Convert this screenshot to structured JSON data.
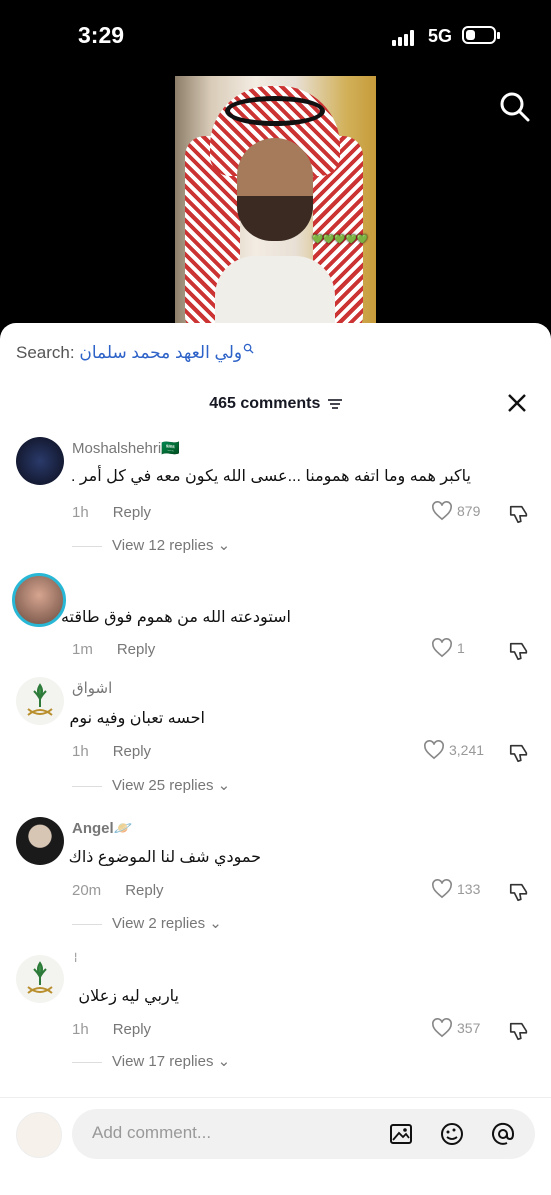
{
  "status": {
    "time": "3:29",
    "network": "5G"
  },
  "video": {
    "caption_ar": "💚💚💚💚💚"
  },
  "sheet": {
    "search_label": "Search:",
    "search_query": "ولي العهد محمد سلمان",
    "comments_count": "465 comments",
    "comments": [
      {
        "username": "Moshalshehri🇸🇦",
        "text": "ياكبر همه وما اتفه همومنا ...عسى الله يكون معه في كل أمر .",
        "time": "1h",
        "reply": "Reply",
        "likes": "879",
        "view_replies": "View 12 replies"
      },
      {
        "username": "",
        "text": "استودعته الله من هموم فوق طاقته",
        "time": "1m",
        "reply": "Reply",
        "likes": "1",
        "view_replies": ""
      },
      {
        "username": "اشواق",
        "text": "احسه تعبان وفيه نوم",
        "time": "1h",
        "reply": "Reply",
        "likes": "3,241",
        "view_replies": "View 25 replies"
      },
      {
        "username": "Angel🪐",
        "text": "حمودي شف لنا الموضوع ذاك",
        "time": "20m",
        "reply": "Reply",
        "likes": "133",
        "view_replies": "View 2 replies"
      },
      {
        "username": "ٰ ٰ",
        "text": "ياربي ليه زعلان",
        "time": "1h",
        "reply": "Reply",
        "likes": "357",
        "view_replies": "View 17 replies"
      }
    ]
  },
  "composer": {
    "placeholder": "Add comment..."
  }
}
